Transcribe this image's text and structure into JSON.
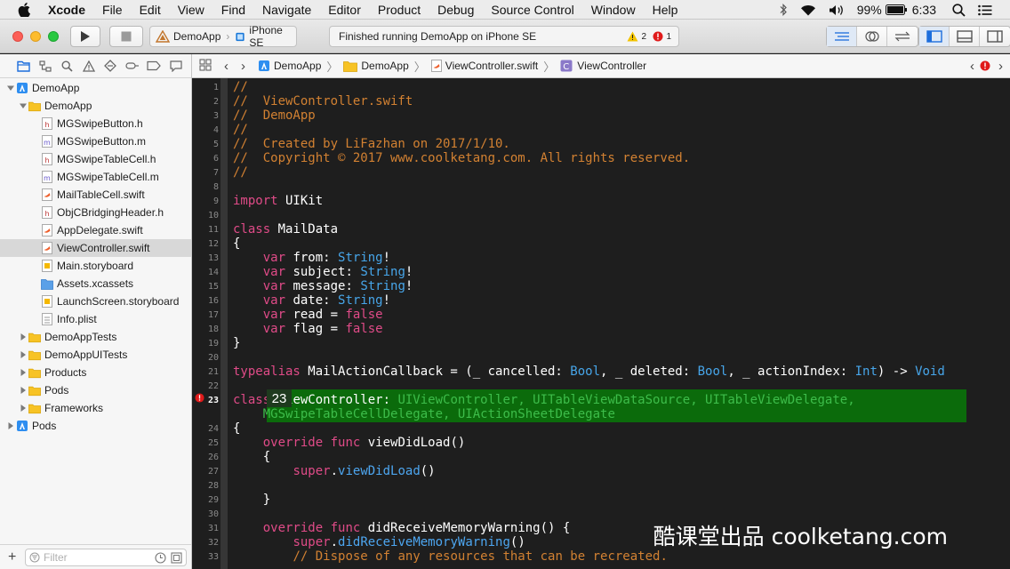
{
  "menubar": {
    "app": "Xcode",
    "items": [
      "File",
      "Edit",
      "View",
      "Find",
      "Navigate",
      "Editor",
      "Product",
      "Debug",
      "Source Control",
      "Window",
      "Help"
    ],
    "battery": "99%",
    "time": "6:33"
  },
  "toolbar": {
    "scheme": "DemoApp",
    "device": "iPhone SE",
    "activity": "Finished running DemoApp on iPhone SE",
    "warnings": "2",
    "errors": "1"
  },
  "navigator": {
    "tree": [
      {
        "label": "DemoApp",
        "icon": "project-icon",
        "level": 0,
        "disclosure": "open"
      },
      {
        "label": "DemoApp",
        "icon": "folder-icon",
        "level": 1,
        "disclosure": "open"
      },
      {
        "label": "MGSwipeButton.h",
        "icon": "header-file-icon",
        "level": 2
      },
      {
        "label": "MGSwipeButton.m",
        "icon": "objc-file-icon",
        "level": 2
      },
      {
        "label": "MGSwipeTableCell.h",
        "icon": "header-file-icon",
        "level": 2
      },
      {
        "label": "MGSwipeTableCell.m",
        "icon": "objc-file-icon",
        "level": 2
      },
      {
        "label": "MailTableCell.swift",
        "icon": "swift-file-icon",
        "level": 2
      },
      {
        "label": "ObjCBridgingHeader.h",
        "icon": "header-file-icon",
        "level": 2
      },
      {
        "label": "AppDelegate.swift",
        "icon": "swift-file-icon",
        "level": 2
      },
      {
        "label": "ViewController.swift",
        "icon": "swift-file-icon",
        "level": 2,
        "selected": true
      },
      {
        "label": "Main.storyboard",
        "icon": "storyboard-icon",
        "level": 2
      },
      {
        "label": "Assets.xcassets",
        "icon": "assets-icon",
        "level": 2
      },
      {
        "label": "LaunchScreen.storyboard",
        "icon": "storyboard-icon",
        "level": 2
      },
      {
        "label": "Info.plist",
        "icon": "plist-icon",
        "level": 2
      },
      {
        "label": "DemoAppTests",
        "icon": "folder-icon",
        "level": 1,
        "disclosure": "closed"
      },
      {
        "label": "DemoAppUITests",
        "icon": "folder-icon",
        "level": 1,
        "disclosure": "closed"
      },
      {
        "label": "Products",
        "icon": "folder-icon",
        "level": 1,
        "disclosure": "closed"
      },
      {
        "label": "Pods",
        "icon": "folder-icon",
        "level": 1,
        "disclosure": "closed"
      },
      {
        "label": "Frameworks",
        "icon": "folder-icon",
        "level": 1,
        "disclosure": "closed"
      },
      {
        "label": "Pods",
        "icon": "project-icon",
        "level": 0,
        "disclosure": "closed"
      }
    ],
    "filter_placeholder": "Filter"
  },
  "jumpbar": {
    "crumbs": [
      "DemoApp",
      "DemoApp",
      "ViewController.swift",
      "ViewController"
    ]
  },
  "editor": {
    "error_line_badge": "23",
    "line_numbers": [
      "1",
      "2",
      "3",
      "4",
      "5",
      "6",
      "7",
      "8",
      "9",
      "10",
      "11",
      "12",
      "13",
      "14",
      "15",
      "16",
      "17",
      "18",
      "19",
      "20",
      "21",
      "22",
      "23",
      "",
      "24",
      "25",
      "26",
      "27",
      "28",
      "29",
      "30",
      "31",
      "32",
      "33"
    ],
    "error_line": "23",
    "lines": [
      [
        {
          "t": "//",
          "c": "cm"
        }
      ],
      [
        {
          "t": "//  ViewController.swift",
          "c": "cm"
        }
      ],
      [
        {
          "t": "//  DemoApp",
          "c": "cm"
        }
      ],
      [
        {
          "t": "//",
          "c": "cm"
        }
      ],
      [
        {
          "t": "//  Created by LiFazhan on 2017/1/10.",
          "c": "cm"
        }
      ],
      [
        {
          "t": "//  Copyright © 2017 www.coolketang.com. All rights reserved.",
          "c": "cm"
        }
      ],
      [
        {
          "t": "//",
          "c": "cm"
        }
      ],
      [],
      [
        {
          "t": "import",
          "c": "kw"
        },
        {
          "t": " UIKit",
          "c": ""
        }
      ],
      [],
      [
        {
          "t": "class",
          "c": "kw"
        },
        {
          "t": " MailData",
          "c": ""
        }
      ],
      [
        {
          "t": "{",
          "c": ""
        }
      ],
      [
        {
          "t": "    ",
          "c": ""
        },
        {
          "t": "var",
          "c": "kw"
        },
        {
          "t": " from: ",
          "c": ""
        },
        {
          "t": "String",
          "c": "ty"
        },
        {
          "t": "!",
          "c": ""
        }
      ],
      [
        {
          "t": "    ",
          "c": ""
        },
        {
          "t": "var",
          "c": "kw"
        },
        {
          "t": " subject: ",
          "c": ""
        },
        {
          "t": "String",
          "c": "ty"
        },
        {
          "t": "!",
          "c": ""
        }
      ],
      [
        {
          "t": "    ",
          "c": ""
        },
        {
          "t": "var",
          "c": "kw"
        },
        {
          "t": " message: ",
          "c": ""
        },
        {
          "t": "String",
          "c": "ty"
        },
        {
          "t": "!",
          "c": ""
        }
      ],
      [
        {
          "t": "    ",
          "c": ""
        },
        {
          "t": "var",
          "c": "kw"
        },
        {
          "t": " date: ",
          "c": ""
        },
        {
          "t": "String",
          "c": "ty"
        },
        {
          "t": "!",
          "c": ""
        }
      ],
      [
        {
          "t": "    ",
          "c": ""
        },
        {
          "t": "var",
          "c": "kw"
        },
        {
          "t": " read = ",
          "c": ""
        },
        {
          "t": "false",
          "c": "kw"
        }
      ],
      [
        {
          "t": "    ",
          "c": ""
        },
        {
          "t": "var",
          "c": "kw"
        },
        {
          "t": " flag = ",
          "c": ""
        },
        {
          "t": "false",
          "c": "kw"
        }
      ],
      [
        {
          "t": "}",
          "c": ""
        }
      ],
      [],
      [
        {
          "t": "typealias",
          "c": "kw"
        },
        {
          "t": " MailActionCallback = (_ cancelled: ",
          "c": ""
        },
        {
          "t": "Bool",
          "c": "ty"
        },
        {
          "t": ", _ deleted: ",
          "c": ""
        },
        {
          "t": "Bool",
          "c": "ty"
        },
        {
          "t": ", _ actionIndex: ",
          "c": ""
        },
        {
          "t": "Int",
          "c": "ty"
        },
        {
          "t": ") -> ",
          "c": ""
        },
        {
          "t": "Void",
          "c": "ty"
        }
      ],
      [],
      [
        {
          "t": "class",
          "c": "kw"
        },
        {
          "t": " ViewController: ",
          "c": ""
        },
        {
          "t": "UIViewController",
          "c": "gr"
        },
        {
          "t": ", ",
          "c": "gr"
        },
        {
          "t": "UITableViewDataSource",
          "c": "gr"
        },
        {
          "t": ", ",
          "c": "gr"
        },
        {
          "t": "UITableViewDelegate",
          "c": "gr"
        },
        {
          "t": ",",
          "c": "gr"
        }
      ],
      [
        {
          "t": "    ",
          "c": ""
        },
        {
          "t": "MGSwipeTableCellDelegate",
          "c": "gr"
        },
        {
          "t": ", ",
          "c": "gr"
        },
        {
          "t": "UIActionSheetDelegate",
          "c": "gr"
        }
      ],
      [
        {
          "t": "{",
          "c": ""
        }
      ],
      [
        {
          "t": "    ",
          "c": ""
        },
        {
          "t": "override",
          "c": "kw"
        },
        {
          "t": " ",
          "c": ""
        },
        {
          "t": "func",
          "c": "kw"
        },
        {
          "t": " viewDidLoad()",
          "c": ""
        }
      ],
      [
        {
          "t": "    {",
          "c": ""
        }
      ],
      [
        {
          "t": "        ",
          "c": ""
        },
        {
          "t": "super",
          "c": "kw"
        },
        {
          "t": ".",
          "c": ""
        },
        {
          "t": "viewDidLoad",
          "c": "bl"
        },
        {
          "t": "()",
          "c": ""
        }
      ],
      [],
      [
        {
          "t": "    }",
          "c": ""
        }
      ],
      [],
      [
        {
          "t": "    ",
          "c": ""
        },
        {
          "t": "override",
          "c": "kw"
        },
        {
          "t": " ",
          "c": ""
        },
        {
          "t": "func",
          "c": "kw"
        },
        {
          "t": " didReceiveMemoryWarning() {",
          "c": ""
        }
      ],
      [
        {
          "t": "        ",
          "c": ""
        },
        {
          "t": "super",
          "c": "kw"
        },
        {
          "t": ".",
          "c": ""
        },
        {
          "t": "didReceiveMemoryWarning",
          "c": "bl"
        },
        {
          "t": "()",
          "c": ""
        }
      ],
      [
        {
          "t": "        ",
          "c": ""
        },
        {
          "t": "// Dispose of any resources that can be recreated.",
          "c": "cm"
        }
      ]
    ]
  },
  "watermark": "酷课堂出品 coolketang.com"
}
